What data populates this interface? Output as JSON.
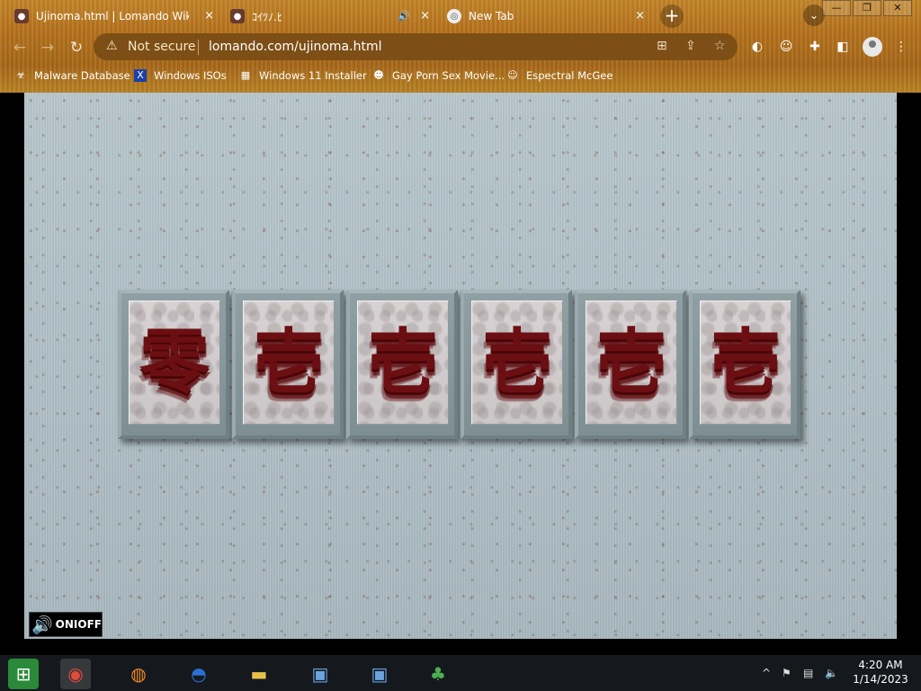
{
  "tabs": [
    {
      "title": "Ujinoma.html | Lomando Wiki | Fa",
      "close": "×"
    },
    {
      "title": "ｺｲﾂﾉ.ﾋ",
      "audio": "🔊",
      "close": "×"
    },
    {
      "title": "New Tab",
      "close": "×"
    }
  ],
  "new_tab": "+",
  "tab_search": "⌄",
  "window_controls": {
    "minimize": "—",
    "maximize": "❐",
    "close": "✕"
  },
  "toolbar": {
    "back": "←",
    "forward": "→",
    "reload": "↻"
  },
  "omnibox": {
    "security_icon": "⚠",
    "security_text": "Not secure",
    "url": "lomando.com/ujinoma.html",
    "translate": "⊞",
    "share": "⇪",
    "bookmark": "☆"
  },
  "extensions": {
    "ext1": "◐",
    "ext2": "☺",
    "puzzle": "✚",
    "sidepanel": "◧",
    "menu": "⋮"
  },
  "bookmarks": [
    {
      "label": "Malware Database",
      "icon": "☣"
    },
    {
      "label": "Windows ISOs",
      "icon": "X"
    },
    {
      "label": "Windows 11 Installer",
      "icon": "▦"
    },
    {
      "label": "Gay Porn Sex Movie...",
      "icon": "☻"
    },
    {
      "label": "Espectral McGee",
      "icon": "☺"
    }
  ],
  "page": {
    "tiles": [
      "零",
      "壱",
      "壱",
      "壱",
      "壱",
      "壱"
    ],
    "sound_toggle": {
      "icon": "🔊",
      "label": "ONIOFF"
    }
  },
  "taskbar": {
    "apps": [
      {
        "name": "start",
        "icon": "⊞"
      },
      {
        "name": "chrome",
        "icon": "◉"
      },
      {
        "name": "firefox",
        "icon": "◍"
      },
      {
        "name": "obama",
        "icon": "◓"
      },
      {
        "name": "explorer",
        "icon": "▬"
      },
      {
        "name": "remote1",
        "icon": "▣"
      },
      {
        "name": "remote2",
        "icon": "▣"
      },
      {
        "name": "network",
        "icon": "♣"
      }
    ],
    "tray": {
      "chevron": "^",
      "flag": "⚑",
      "net": "▤",
      "volume": "🔈"
    },
    "time": "4:20 AM",
    "date": "1/14/2023"
  },
  "colors": {
    "chrome_accent": "#b6731d",
    "tile_glyph": "#6b0f12",
    "page_bg": "#b0c1c7"
  }
}
